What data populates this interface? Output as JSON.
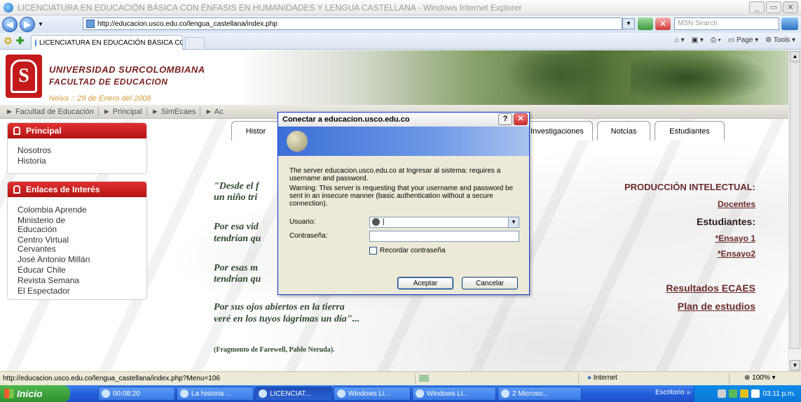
{
  "window": {
    "title": "LICENCIATURA EN EDUCACIÓN BÁSICA CON ÉNFASIS EN HUMANIDADES Y LENGUA CASTELLANA - Windows Internet Explorer"
  },
  "toolbar": {
    "address": "http://educacion.usco.edu.co/lengua_castellana/index.php",
    "search_placeholder": "MSN Search",
    "tab_title": "LICENCIATURA EN EDUCACIÓN BÁSICA CON ÉNFASI...",
    "page_label": "Page",
    "tools_label": "Tools"
  },
  "site": {
    "university": "UNIVERSIDAD SURCOLOMBIANA",
    "faculty": "FACULTAD DE EDUCACION",
    "date": "Neiva :: 29 de Enero del 2008",
    "menu": [
      "► Facultad de Educación",
      "► Principal",
      "► SimEcaes",
      "► Ac"
    ]
  },
  "sidebar": {
    "principal_title": "Principal",
    "principal_links": [
      "Nosotros",
      "Historia"
    ],
    "enlaces_title": "Enlaces de Interés",
    "enlaces_links": [
      "Colombia Aprende",
      "Ministerio de Educación",
      "Centro Virtual Cervantes",
      "José Antonio Millán",
      "Educar Chile",
      "Revista Semana",
      "El Espectador"
    ]
  },
  "tabs": [
    "Histor",
    "Investigaciones",
    "Notcias",
    "Estudiantes"
  ],
  "poem": {
    "l1": "\"Desde el f",
    "l2": "un niño tri",
    "l3": "Por esa vid",
    "l4": "tendrían qu",
    "l5": "Por esas m",
    "l6": "tendrían qu",
    "l7": "Por sus ojos abiertos en la tierra",
    "l8": "veré en los tuyos lágrimas un día\"...",
    "fragment": "(Fragmento de Farewell, Pablo Neruda)."
  },
  "right_links": {
    "produccion": "PRODUCCIÓN INTELECTUAL:",
    "docentes": "Docentes",
    "estudiantes": "Estudiantes:",
    "ensayo1": "*Ensayo 1",
    "ensayo2": "*Ensayo2",
    "resultados": "Resultados ECAES",
    "plan": "Plan de estudios"
  },
  "dialog": {
    "title": "Conectar a educacion.usco.edu.co",
    "message1": "The server educacion.usco.edu.co at Ingresar al sistema: requires a username and password.",
    "message2": "Warning: This server is requesting that your username and password be sent in an insecure manner (basic authentication without a secure connection).",
    "user_label": "Usuario:",
    "user_value": "|",
    "pass_label": "Contraseña:",
    "remember_label": "Recordar contraseña",
    "ok_label": "Aceptar",
    "cancel_label": "Cancelar"
  },
  "status": {
    "url": "http://educacion.usco.edu.co/lengua_castellana/index.php?Menu=106",
    "zone": "Internet",
    "zoom": "100%"
  },
  "taskbar": {
    "start": "Inicio",
    "items": [
      "00:08:20",
      "La historia ...",
      "LICENCIAT...",
      "Windows Li...",
      "Windows Li...",
      "2 Microso..."
    ],
    "desktop": "Escritorio",
    "clock": "03:11 p.m."
  }
}
